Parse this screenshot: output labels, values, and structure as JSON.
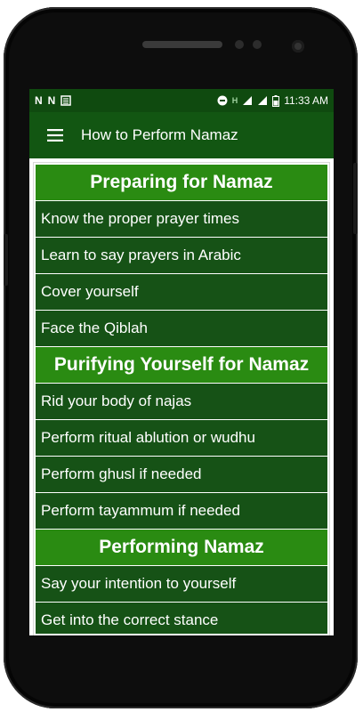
{
  "status_bar": {
    "left_icons": [
      "N",
      "N",
      "news-icon"
    ],
    "time": "11:33 AM",
    "network_letter": "H"
  },
  "app_bar": {
    "title": "How to Perform Namaz",
    "menu_icon": "hamburger-menu-icon"
  },
  "colors": {
    "status_bar": "#0f4a0f",
    "app_bar": "#125612",
    "item_row": "#165216",
    "section_header": "#2a8b12"
  },
  "sections": [
    {
      "title": "Preparing for Namaz",
      "items": [
        "Know the proper prayer times",
        "Learn to say prayers in Arabic",
        "Cover yourself",
        "Face the Qiblah"
      ]
    },
    {
      "title": "Purifying Yourself for Namaz",
      "items": [
        "Rid your body of najas",
        "Perform ritual ablution or wudhu",
        "Perform ghusl if needed",
        "Perform tayammum if needed"
      ]
    },
    {
      "title": "Performing Namaz",
      "items": [
        "Say your intention to yourself",
        "Get into the correct stance"
      ]
    }
  ]
}
